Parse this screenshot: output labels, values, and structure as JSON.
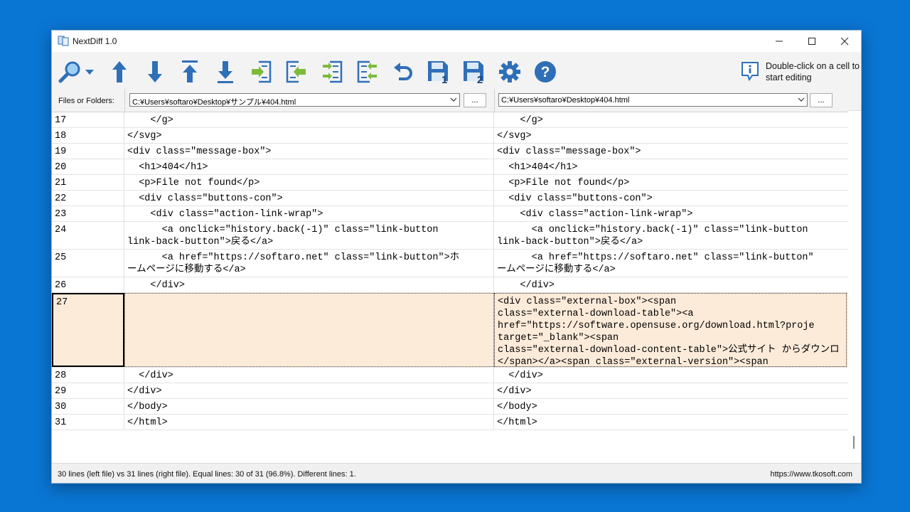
{
  "window": {
    "title": "NextDiff 1.0"
  },
  "toolbar": {
    "hint": "Double-click on a cell to start editing",
    "buttons": [
      {
        "name": "search-icon"
      },
      {
        "name": "dropdown-arrow-icon"
      },
      {
        "name": "previous-diff-icon"
      },
      {
        "name": "next-diff-icon"
      },
      {
        "name": "first-diff-icon"
      },
      {
        "name": "last-diff-icon"
      },
      {
        "name": "copy-to-left-icon"
      },
      {
        "name": "copy-from-left-icon"
      },
      {
        "name": "copy-all-to-right-icon"
      },
      {
        "name": "copy-all-to-left-icon"
      },
      {
        "name": "undo-icon"
      },
      {
        "name": "save-left-icon"
      },
      {
        "name": "save-right-icon"
      },
      {
        "name": "settings-icon"
      },
      {
        "name": "help-icon"
      }
    ]
  },
  "files": {
    "label": "Files or Folders:",
    "left_path": "C:¥Users¥softaro¥Desktop¥サンプル¥404.html",
    "right_path": "C:¥Users¥softaro¥Desktop¥404.html",
    "browse_label": "..."
  },
  "rows": [
    {
      "n": "17",
      "l": "    </g>",
      "r": "    </g>"
    },
    {
      "n": "18",
      "l": "</svg>",
      "r": "</svg>"
    },
    {
      "n": "19",
      "l": "<div class=\"message-box\">",
      "r": "<div class=\"message-box\">"
    },
    {
      "n": "20",
      "l": "  <h1>404</h1>",
      "r": "  <h1>404</h1>"
    },
    {
      "n": "21",
      "l": "  <p>File not found</p>",
      "r": "  <p>File not found</p>"
    },
    {
      "n": "22",
      "l": "  <div class=\"buttons-con\">",
      "r": "  <div class=\"buttons-con\">"
    },
    {
      "n": "23",
      "l": "    <div class=\"action-link-wrap\">",
      "r": "    <div class=\"action-link-wrap\">"
    },
    {
      "n": "24",
      "l": "      <a onclick=\"history.back(-1)\" class=\"link-button\nlink-back-button\">戻る</a>",
      "r": "      <a onclick=\"history.back(-1)\" class=\"link-button\nlink-back-button\">戻る</a>"
    },
    {
      "n": "25",
      "l": "      <a href=\"https://softaro.net\" class=\"link-button\">ホ\nームページに移動する</a>",
      "r": "      <a href=\"https://softaro.net\" class=\"link-button\"\nームページに移動する</a>"
    },
    {
      "n": "26",
      "l": "    </div>",
      "r": "    </div>"
    },
    {
      "n": "27",
      "l": "",
      "r": "<div class=\"external-box\"><span\nclass=\"external-download-table\"><a\nhref=\"https://software.opensuse.org/download.html?proje\ntarget=\"_blank\"><span\nclass=\"external-download-content-table\">公式サイト からダウンロ\n</span></a><span class=\"external-version\"><span",
      "diff": true
    },
    {
      "n": "28",
      "l": "  </div>",
      "r": "  </div>"
    },
    {
      "n": "29",
      "l": "</div>",
      "r": "</div>"
    },
    {
      "n": "30",
      "l": "</body>",
      "r": "</body>"
    },
    {
      "n": "31",
      "l": "</html>",
      "r": "</html>"
    }
  ],
  "status": {
    "summary": "30 lines (left file) vs 31 lines (right file). Equal lines: 30 of 31 (96.8%). Different lines: 1.",
    "url": "https://www.tkosoft.com"
  },
  "colors": {
    "desktop": "#0a76d4",
    "icon_blue": "#2f6fb8",
    "icon_green": "#7cbb3a",
    "diff_bg": "#fdebd9"
  }
}
